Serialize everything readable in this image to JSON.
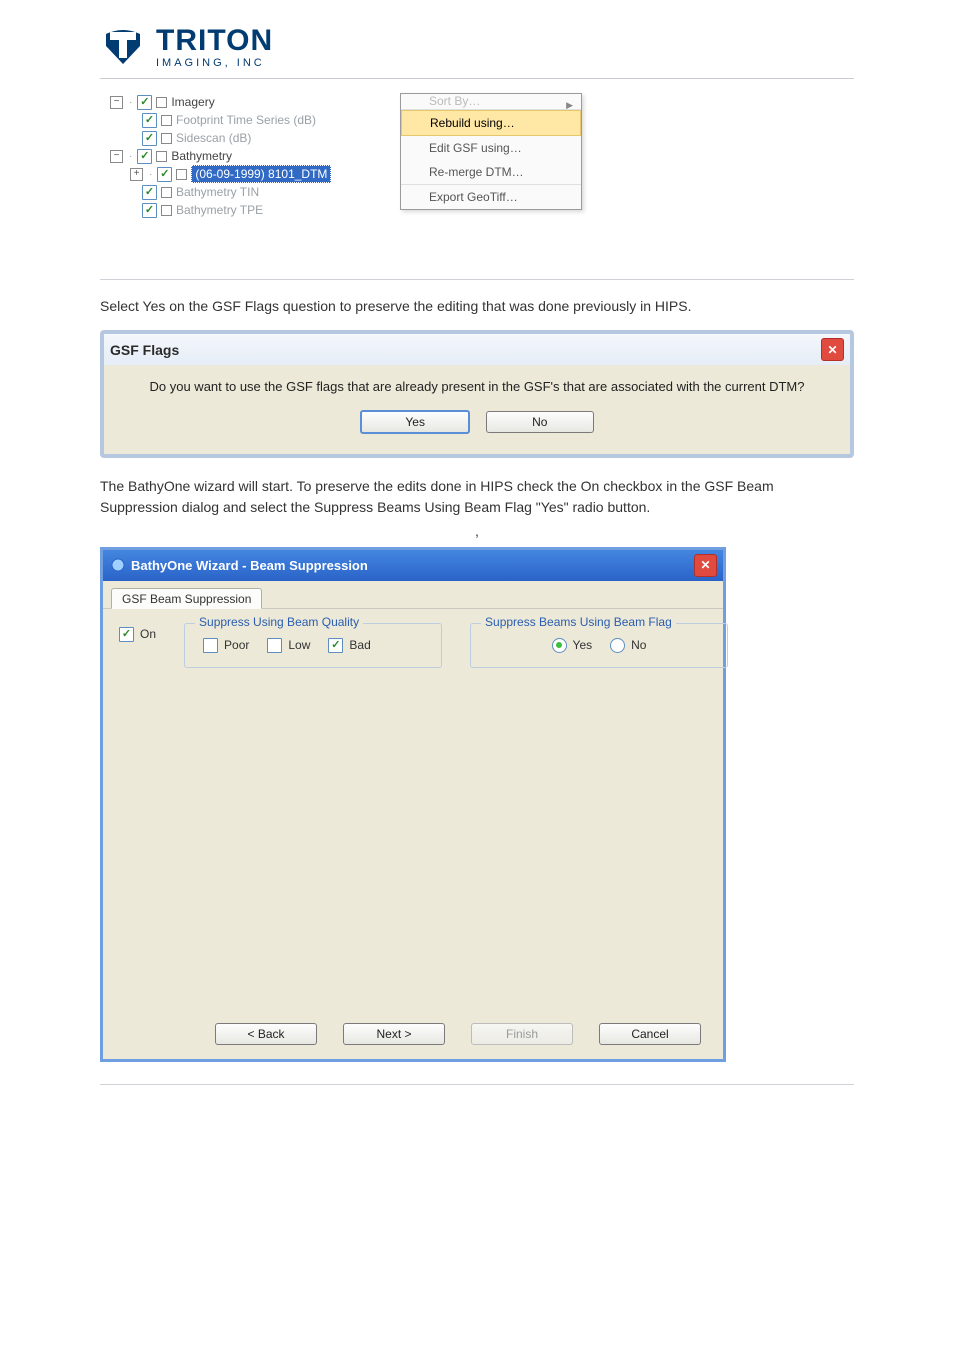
{
  "logo": {
    "brand": "TRITON",
    "tagline": "IMAGING, INC"
  },
  "tree": {
    "items": [
      {
        "level": 0,
        "expander": "-",
        "checked": true,
        "swatch": true,
        "label": "Imagery",
        "dim": false
      },
      {
        "level": 1,
        "expander": "",
        "checked": true,
        "swatch": true,
        "label": "Footprint Time Series (dB)",
        "dim": true
      },
      {
        "level": 1,
        "expander": "",
        "checked": true,
        "swatch": true,
        "label": "Sidescan (dB)",
        "dim": true
      },
      {
        "level": 0,
        "expander": "-",
        "checked": true,
        "swatch": true,
        "label": "Bathymetry",
        "dim": false
      },
      {
        "level": 1,
        "expander": "+",
        "checked": true,
        "swatch": true,
        "label": "(06-09-1999) 8101_DTM",
        "dim": false,
        "selected": true
      },
      {
        "level": 1,
        "expander": "",
        "checked": true,
        "swatch": true,
        "label": "Bathymetry TIN",
        "dim": true
      },
      {
        "level": 1,
        "expander": "",
        "checked": true,
        "swatch": true,
        "label": "Bathymetry TPE",
        "dim": true
      }
    ]
  },
  "context_menu": {
    "cutoff_label": "Sort By…",
    "items": [
      {
        "label": "Rebuild using…",
        "highlight": true,
        "sep_after": true
      },
      {
        "label": "Edit GSF using…"
      },
      {
        "label": "Re-merge DTM…",
        "sep_after": true
      },
      {
        "label": "Export GeoTiff…"
      }
    ]
  },
  "para1": "Select Yes on the GSF Flags question to preserve the editing that was done previously in HIPS.",
  "gsf_dialog": {
    "title": "GSF Flags",
    "question": "Do you want to use the GSF flags that are already present in the GSF's that are associated with the current DTM?",
    "yes": "Yes",
    "no": "No"
  },
  "para2": "The BathyOne wizard will start. To preserve the edits done in HIPS check the On checkbox in the GSF Beam Suppression dialog and select the Suppress Beams Using Beam Flag \"Yes\" radio button.",
  "comma_note": ",",
  "wizard": {
    "title": "BathyOne Wizard - Beam Suppression",
    "tab": "GSF Beam Suppression",
    "on_label": "On",
    "group_quality": {
      "legend": "Suppress Using Beam Quality",
      "poor": "Poor",
      "low": "Low",
      "bad": "Bad",
      "poor_checked": false,
      "low_checked": false,
      "bad_checked": true
    },
    "group_flag": {
      "legend": "Suppress Beams Using Beam Flag",
      "yes": "Yes",
      "no": "No",
      "selected": "yes"
    },
    "buttons": {
      "back": "< Back",
      "next": "Next >",
      "finish": "Finish",
      "cancel": "Cancel"
    }
  }
}
